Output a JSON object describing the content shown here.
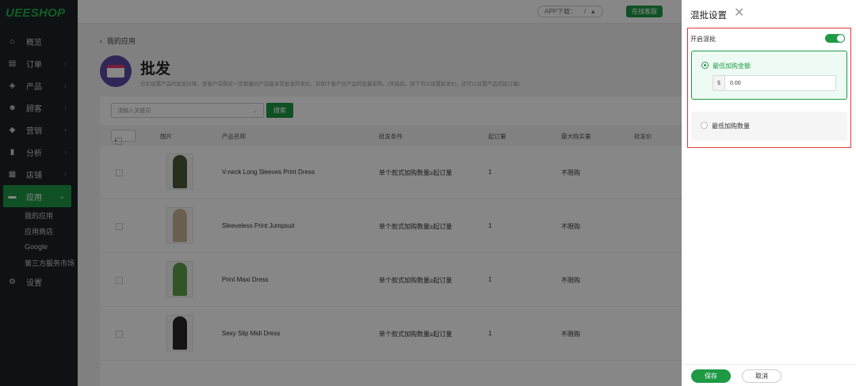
{
  "brand": "UEESHOP",
  "nav": [
    {
      "label": "概览",
      "icon": "home-icon",
      "glyph": "⌂",
      "chev": false
    },
    {
      "label": "订单",
      "icon": "order-icon",
      "glyph": "▤",
      "chev": true
    },
    {
      "label": "产品",
      "icon": "product-icon",
      "glyph": "◈",
      "chev": true
    },
    {
      "label": "顾客",
      "icon": "customer-icon",
      "glyph": "☻",
      "chev": true
    },
    {
      "label": "营销",
      "icon": "tag-icon",
      "glyph": "◆",
      "chev": true
    },
    {
      "label": "分析",
      "icon": "chart-icon",
      "glyph": "▮",
      "chev": true
    },
    {
      "label": "店铺",
      "icon": "store-icon",
      "glyph": "▦",
      "chev": true
    },
    {
      "label": "应用",
      "icon": "apps-icon",
      "glyph": "▬",
      "chev": true,
      "active": true
    }
  ],
  "subnav": [
    "我的应用",
    "应用商店",
    "Google",
    "第三方服务市场"
  ],
  "settings_label": "设置",
  "topbar": {
    "app_download": "APP下载：",
    "support": "在线客服"
  },
  "back_label": "我的应用",
  "page": {
    "title": "批发",
    "desc": "分别设置产品的批发价格，使客户在购买一定数量的产品能享受批发的单价，有助于客户对产品的批量采购。(开启后，除了可以设置批发价，还可以设置产品的起订量)",
    "search_placeholder": "请输入关键词",
    "search_button": "搜索"
  },
  "table": {
    "headers": [
      "图片",
      "产品名称",
      "批发条件",
      "起订量",
      "最大购买量",
      "批发价"
    ],
    "rows": [
      {
        "name": "V-neck Long Sleeves Print Dress",
        "condition": "单个款式加购数量≥起订量",
        "moq": "1",
        "max": "不限购",
        "color": "#4b5a3c"
      },
      {
        "name": "Sleeveless Print Jumpsuit",
        "condition": "单个款式加购数量≥起订量",
        "moq": "1",
        "max": "不限购",
        "color": "#c9b49a"
      },
      {
        "name": "Print Maxi Dress",
        "condition": "单个款式加购数量≥起订量",
        "moq": "1",
        "max": "不限购",
        "color": "#5fa04a"
      },
      {
        "name": "Sexy Slip Midi Dress",
        "condition": "单个款式加购数量≥起订量",
        "moq": "1",
        "max": "不限购",
        "color": "#2b2426"
      }
    ]
  },
  "drawer": {
    "title": "混批设置",
    "toggle_label": "开启混批",
    "toggle_on": true,
    "option1": "最低加购金额",
    "currency": "$",
    "amount": "0.00",
    "option2": "最低加购数量",
    "save": "保存",
    "cancel": "取消",
    "accent": "#1e9a45",
    "highlight": "#e23838"
  }
}
